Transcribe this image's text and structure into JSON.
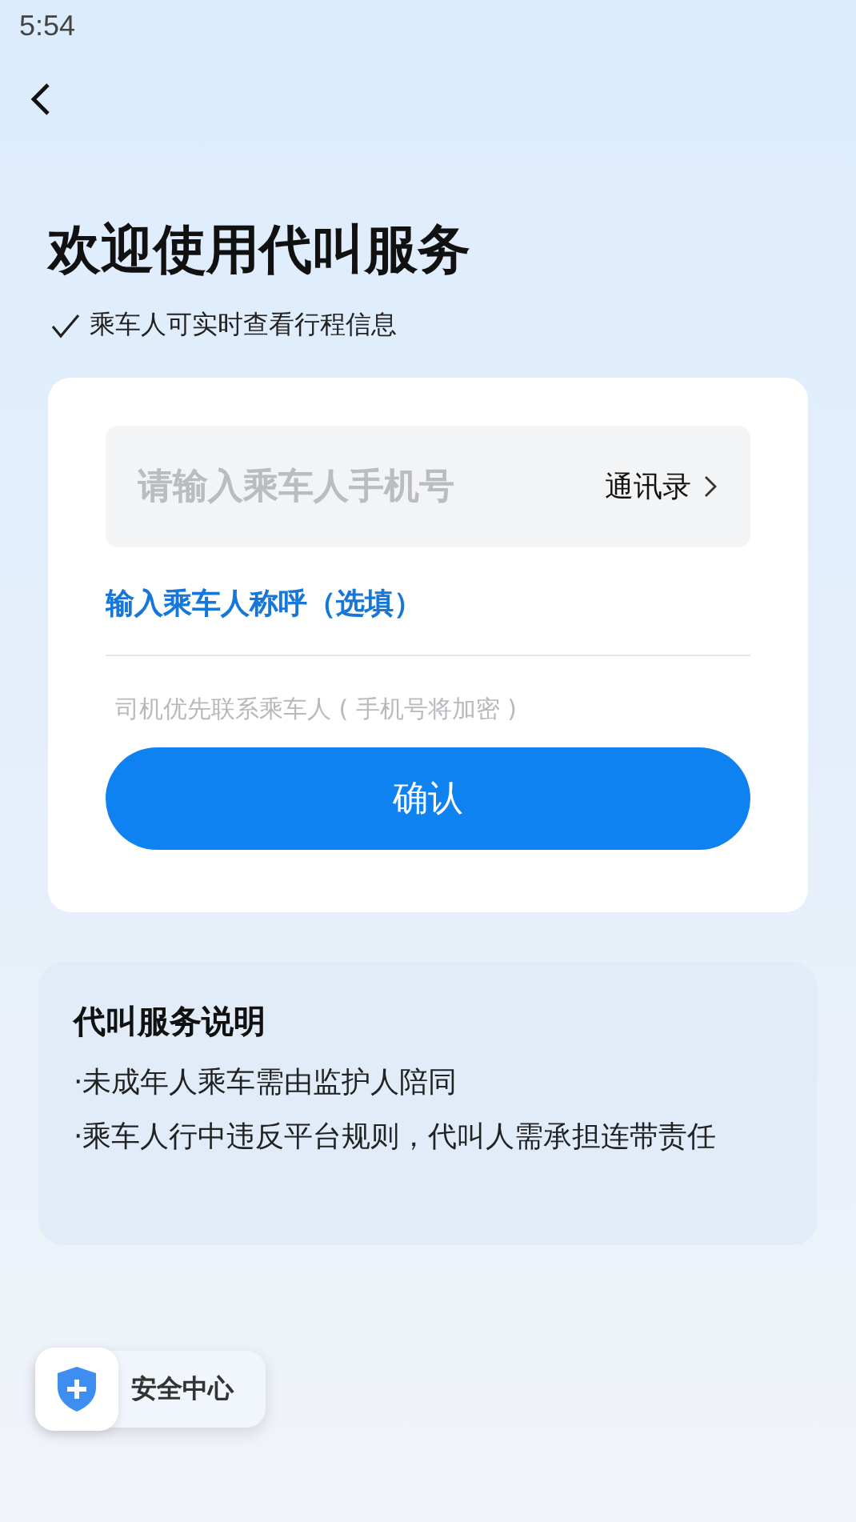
{
  "status_bar": {
    "time": "5:54"
  },
  "title": "欢迎使用代叫服务",
  "subtitle": "乘车人可实时查看行程信息",
  "form": {
    "phone_field": {
      "placeholder": "请输入乘车人手机号"
    },
    "contacts_link": "通讯录",
    "name_field": {
      "placeholder": "输入乘车人称呼（选填）"
    },
    "hint": "司机优先联系乘车人 ( 手机号将加密 )",
    "confirm_button": "确认"
  },
  "info": {
    "title": "代叫服务说明",
    "items": [
      "·未成年人乘车需由监护人陪同",
      "·乘车人行中违反平台规则，代叫人需承担连带责任"
    ]
  },
  "safety_button": "安全中心"
}
